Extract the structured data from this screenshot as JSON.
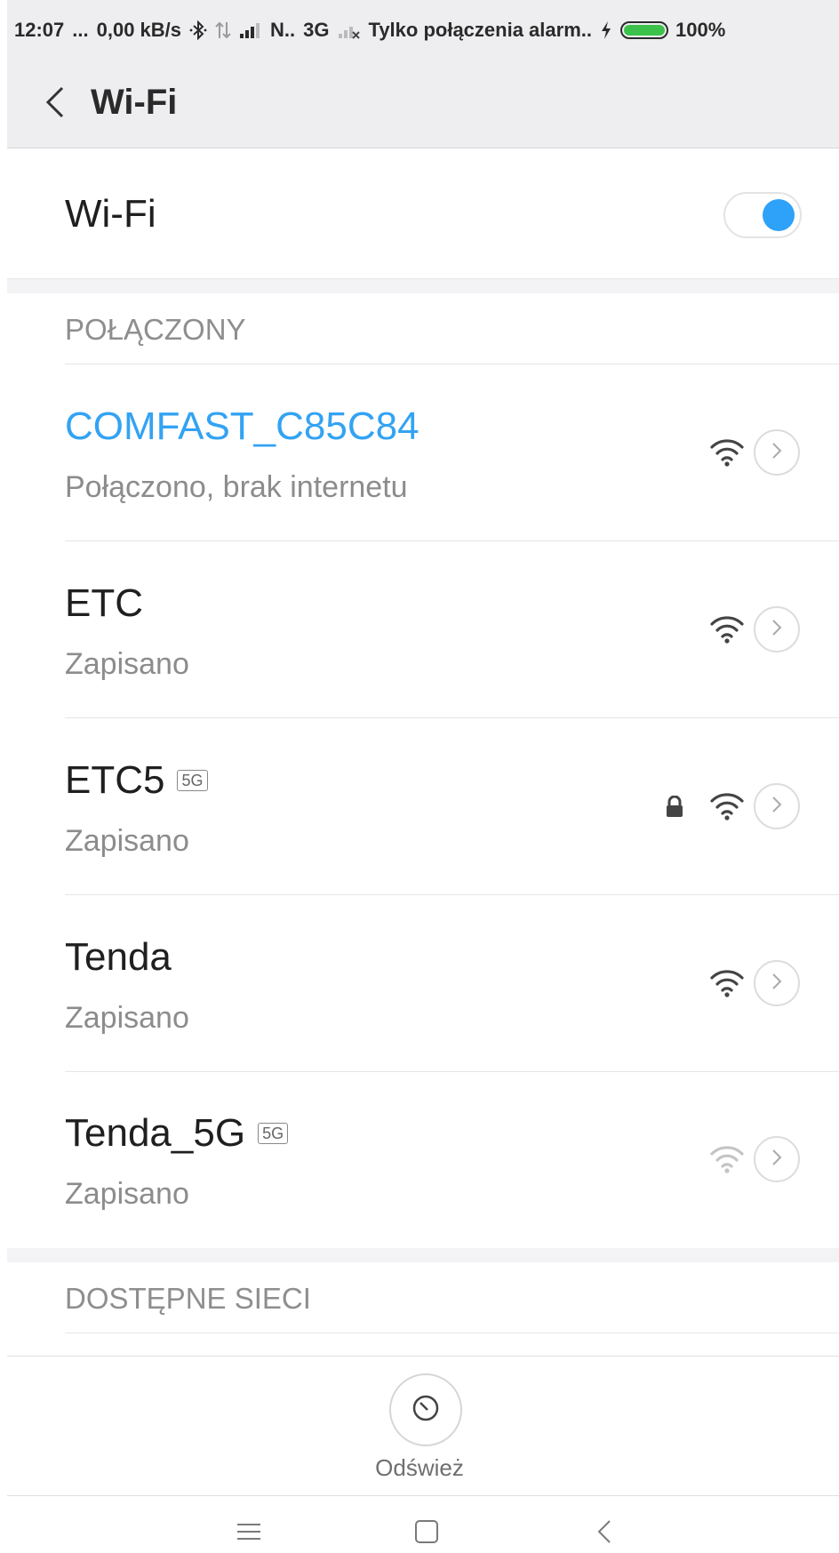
{
  "status_bar": {
    "time": "12:07",
    "dots": "...",
    "data_rate": "0,00 kB/s",
    "carrier": "N..",
    "network_type": "3G",
    "carrier_message": "Tylko połączenia alarm..",
    "battery_percent": "100%",
    "battery_level": 1.0,
    "icons": [
      "bluetooth-icon",
      "data-arrows-icon",
      "signal-icon",
      "signal-no-service-icon",
      "charging-icon",
      "battery-icon"
    ]
  },
  "header": {
    "back_icon": "chevron-left-icon",
    "title": "Wi-Fi"
  },
  "wifi_toggle": {
    "label": "Wi-Fi",
    "enabled": true,
    "accent_color": "#2ea1f8"
  },
  "sections": {
    "connected_header": "POŁĄCZONY",
    "available_header": "DOSTĘPNE SIECI"
  },
  "networks": [
    {
      "name": "COMFAST_C85C84",
      "status": "Połączono, brak internetu",
      "connected": true,
      "badge": "",
      "locked": false,
      "signal": "strong"
    },
    {
      "name": "ETC",
      "status": "Zapisano",
      "connected": false,
      "badge": "",
      "locked": false,
      "signal": "strong"
    },
    {
      "name": "ETC5",
      "status": "Zapisano",
      "connected": false,
      "badge": "5G",
      "locked": true,
      "signal": "strong"
    },
    {
      "name": "Tenda",
      "status": "Zapisano",
      "connected": false,
      "badge": "",
      "locked": false,
      "signal": "strong"
    },
    {
      "name": "Tenda_5G",
      "status": "Zapisano",
      "connected": false,
      "badge": "5G",
      "locked": false,
      "signal": "weak"
    }
  ],
  "refresh": {
    "label": "Odśwież",
    "icon": "refresh-icon"
  },
  "nav_bar": {
    "icons": [
      "menu-icon",
      "home-icon",
      "back-icon"
    ]
  },
  "colors": {
    "connected_text": "#33a3f3",
    "battery_fill": "#3cc24a",
    "header_bg": "#eeeef0"
  }
}
